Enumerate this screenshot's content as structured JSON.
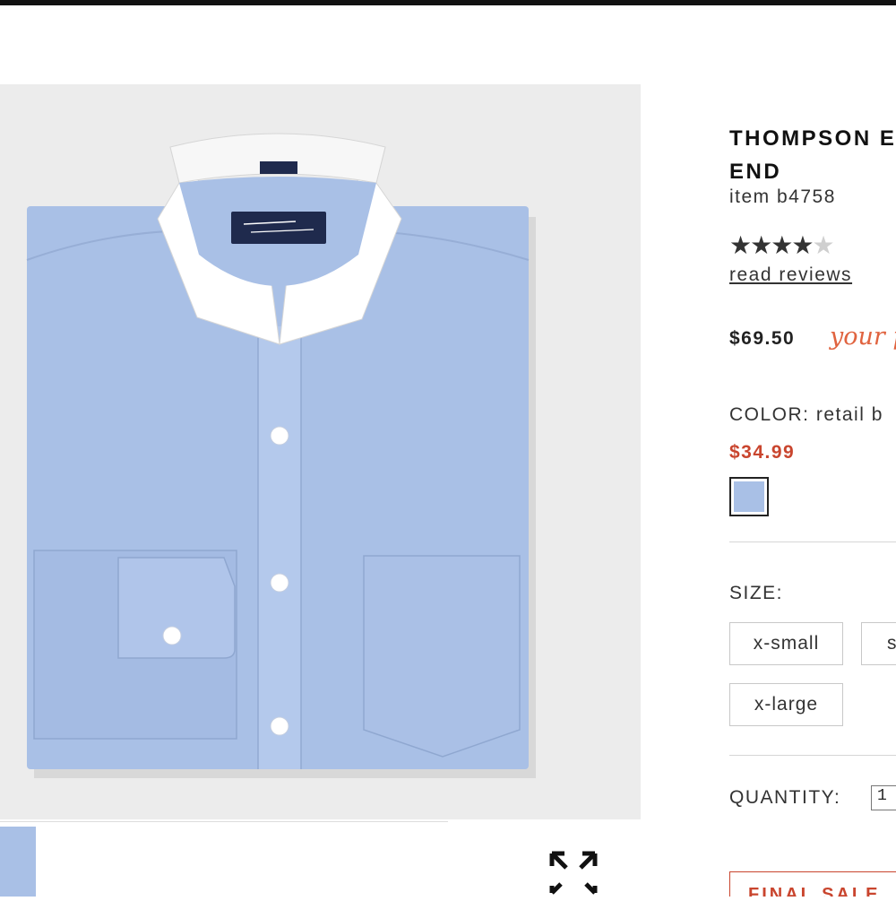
{
  "product": {
    "title": "THOMPSON END",
    "title_line1": "THOMPSON E",
    "title_line2": "END",
    "item_number": "item b4758",
    "rating_stars_filled": 4,
    "rating_stars_total": 5,
    "read_reviews_label": "read reviews",
    "price": "$69.50",
    "promo_text": "your p",
    "color_label": "COLOR: retail b",
    "sale_price": "$34.99",
    "swatch_color": "#a9c0e6",
    "size_label": "SIZE:",
    "sizes": [
      "x-small",
      "s",
      "x-large"
    ],
    "quantity_label": "QUANTITY:",
    "quantity_value": "1",
    "final_sale_label": "FINAL SALE"
  },
  "image": {
    "shirt_color": "#a9c0e6",
    "collar_color": "#ffffff",
    "label_color": "#1f2a4d"
  },
  "colors": {
    "accent_red": "#c9452e",
    "promo_orange": "#e0633f",
    "text": "#222222"
  }
}
